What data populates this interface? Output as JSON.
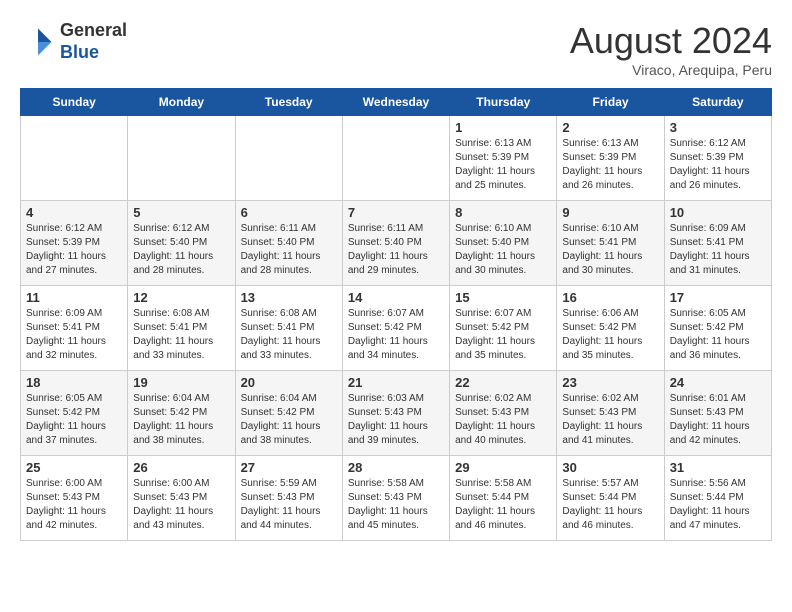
{
  "header": {
    "logo_general": "General",
    "logo_blue": "Blue",
    "month_year": "August 2024",
    "location": "Viraco, Arequipa, Peru"
  },
  "weekdays": [
    "Sunday",
    "Monday",
    "Tuesday",
    "Wednesday",
    "Thursday",
    "Friday",
    "Saturday"
  ],
  "weeks": [
    [
      {
        "day": "",
        "sunrise": "",
        "sunset": "",
        "daylight": ""
      },
      {
        "day": "",
        "sunrise": "",
        "sunset": "",
        "daylight": ""
      },
      {
        "day": "",
        "sunrise": "",
        "sunset": "",
        "daylight": ""
      },
      {
        "day": "",
        "sunrise": "",
        "sunset": "",
        "daylight": ""
      },
      {
        "day": "1",
        "sunrise": "Sunrise: 6:13 AM",
        "sunset": "Sunset: 5:39 PM",
        "daylight": "Daylight: 11 hours and 25 minutes."
      },
      {
        "day": "2",
        "sunrise": "Sunrise: 6:13 AM",
        "sunset": "Sunset: 5:39 PM",
        "daylight": "Daylight: 11 hours and 26 minutes."
      },
      {
        "day": "3",
        "sunrise": "Sunrise: 6:12 AM",
        "sunset": "Sunset: 5:39 PM",
        "daylight": "Daylight: 11 hours and 26 minutes."
      }
    ],
    [
      {
        "day": "4",
        "sunrise": "Sunrise: 6:12 AM",
        "sunset": "Sunset: 5:39 PM",
        "daylight": "Daylight: 11 hours and 27 minutes."
      },
      {
        "day": "5",
        "sunrise": "Sunrise: 6:12 AM",
        "sunset": "Sunset: 5:40 PM",
        "daylight": "Daylight: 11 hours and 28 minutes."
      },
      {
        "day": "6",
        "sunrise": "Sunrise: 6:11 AM",
        "sunset": "Sunset: 5:40 PM",
        "daylight": "Daylight: 11 hours and 28 minutes."
      },
      {
        "day": "7",
        "sunrise": "Sunrise: 6:11 AM",
        "sunset": "Sunset: 5:40 PM",
        "daylight": "Daylight: 11 hours and 29 minutes."
      },
      {
        "day": "8",
        "sunrise": "Sunrise: 6:10 AM",
        "sunset": "Sunset: 5:40 PM",
        "daylight": "Daylight: 11 hours and 30 minutes."
      },
      {
        "day": "9",
        "sunrise": "Sunrise: 6:10 AM",
        "sunset": "Sunset: 5:41 PM",
        "daylight": "Daylight: 11 hours and 30 minutes."
      },
      {
        "day": "10",
        "sunrise": "Sunrise: 6:09 AM",
        "sunset": "Sunset: 5:41 PM",
        "daylight": "Daylight: 11 hours and 31 minutes."
      }
    ],
    [
      {
        "day": "11",
        "sunrise": "Sunrise: 6:09 AM",
        "sunset": "Sunset: 5:41 PM",
        "daylight": "Daylight: 11 hours and 32 minutes."
      },
      {
        "day": "12",
        "sunrise": "Sunrise: 6:08 AM",
        "sunset": "Sunset: 5:41 PM",
        "daylight": "Daylight: 11 hours and 33 minutes."
      },
      {
        "day": "13",
        "sunrise": "Sunrise: 6:08 AM",
        "sunset": "Sunset: 5:41 PM",
        "daylight": "Daylight: 11 hours and 33 minutes."
      },
      {
        "day": "14",
        "sunrise": "Sunrise: 6:07 AM",
        "sunset": "Sunset: 5:42 PM",
        "daylight": "Daylight: 11 hours and 34 minutes."
      },
      {
        "day": "15",
        "sunrise": "Sunrise: 6:07 AM",
        "sunset": "Sunset: 5:42 PM",
        "daylight": "Daylight: 11 hours and 35 minutes."
      },
      {
        "day": "16",
        "sunrise": "Sunrise: 6:06 AM",
        "sunset": "Sunset: 5:42 PM",
        "daylight": "Daylight: 11 hours and 35 minutes."
      },
      {
        "day": "17",
        "sunrise": "Sunrise: 6:05 AM",
        "sunset": "Sunset: 5:42 PM",
        "daylight": "Daylight: 11 hours and 36 minutes."
      }
    ],
    [
      {
        "day": "18",
        "sunrise": "Sunrise: 6:05 AM",
        "sunset": "Sunset: 5:42 PM",
        "daylight": "Daylight: 11 hours and 37 minutes."
      },
      {
        "day": "19",
        "sunrise": "Sunrise: 6:04 AM",
        "sunset": "Sunset: 5:42 PM",
        "daylight": "Daylight: 11 hours and 38 minutes."
      },
      {
        "day": "20",
        "sunrise": "Sunrise: 6:04 AM",
        "sunset": "Sunset: 5:42 PM",
        "daylight": "Daylight: 11 hours and 38 minutes."
      },
      {
        "day": "21",
        "sunrise": "Sunrise: 6:03 AM",
        "sunset": "Sunset: 5:43 PM",
        "daylight": "Daylight: 11 hours and 39 minutes."
      },
      {
        "day": "22",
        "sunrise": "Sunrise: 6:02 AM",
        "sunset": "Sunset: 5:43 PM",
        "daylight": "Daylight: 11 hours and 40 minutes."
      },
      {
        "day": "23",
        "sunrise": "Sunrise: 6:02 AM",
        "sunset": "Sunset: 5:43 PM",
        "daylight": "Daylight: 11 hours and 41 minutes."
      },
      {
        "day": "24",
        "sunrise": "Sunrise: 6:01 AM",
        "sunset": "Sunset: 5:43 PM",
        "daylight": "Daylight: 11 hours and 42 minutes."
      }
    ],
    [
      {
        "day": "25",
        "sunrise": "Sunrise: 6:00 AM",
        "sunset": "Sunset: 5:43 PM",
        "daylight": "Daylight: 11 hours and 42 minutes."
      },
      {
        "day": "26",
        "sunrise": "Sunrise: 6:00 AM",
        "sunset": "Sunset: 5:43 PM",
        "daylight": "Daylight: 11 hours and 43 minutes."
      },
      {
        "day": "27",
        "sunrise": "Sunrise: 5:59 AM",
        "sunset": "Sunset: 5:43 PM",
        "daylight": "Daylight: 11 hours and 44 minutes."
      },
      {
        "day": "28",
        "sunrise": "Sunrise: 5:58 AM",
        "sunset": "Sunset: 5:43 PM",
        "daylight": "Daylight: 11 hours and 45 minutes."
      },
      {
        "day": "29",
        "sunrise": "Sunrise: 5:58 AM",
        "sunset": "Sunset: 5:44 PM",
        "daylight": "Daylight: 11 hours and 46 minutes."
      },
      {
        "day": "30",
        "sunrise": "Sunrise: 5:57 AM",
        "sunset": "Sunset: 5:44 PM",
        "daylight": "Daylight: 11 hours and 46 minutes."
      },
      {
        "day": "31",
        "sunrise": "Sunrise: 5:56 AM",
        "sunset": "Sunset: 5:44 PM",
        "daylight": "Daylight: 11 hours and 47 minutes."
      }
    ]
  ]
}
